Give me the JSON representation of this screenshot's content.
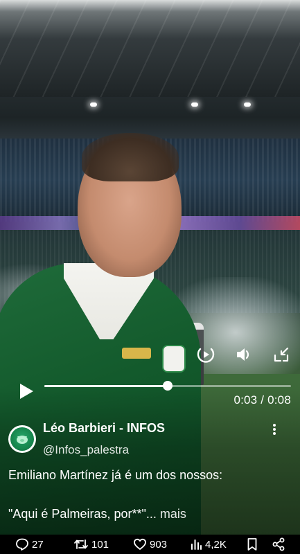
{
  "video": {
    "current_time": "0:03",
    "duration": "0:08",
    "time_separator": " / ",
    "progress_fraction": 0.5
  },
  "author": {
    "name": "Léo Barbieri - INFOS",
    "handle": "@Infos_palestra",
    "avatar_label": "Infos Palestra"
  },
  "caption": {
    "line1": "Emiliano Martínez já é um dos nossos:",
    "line2": "\"Aqui é Palmeiras, por**\"...",
    "more_label": " mais"
  },
  "actions": {
    "replies": "27",
    "reposts": "101",
    "likes": "903",
    "views": "4,2K"
  },
  "icons": {
    "play": "play-icon",
    "play_inline": "play-circle-icon",
    "volume": "volume-icon",
    "fullscreen": "fullscreen-exit-icon",
    "more": "more-vertical-icon",
    "reply": "reply-icon",
    "repost": "repost-icon",
    "like": "heart-icon",
    "views": "views-chart-icon",
    "bookmark": "bookmark-icon",
    "share": "share-icon"
  },
  "colors": {
    "text": "#ffffff",
    "bar_background": "#000000",
    "progress_track": "rgba(255,255,255,0.45)"
  }
}
